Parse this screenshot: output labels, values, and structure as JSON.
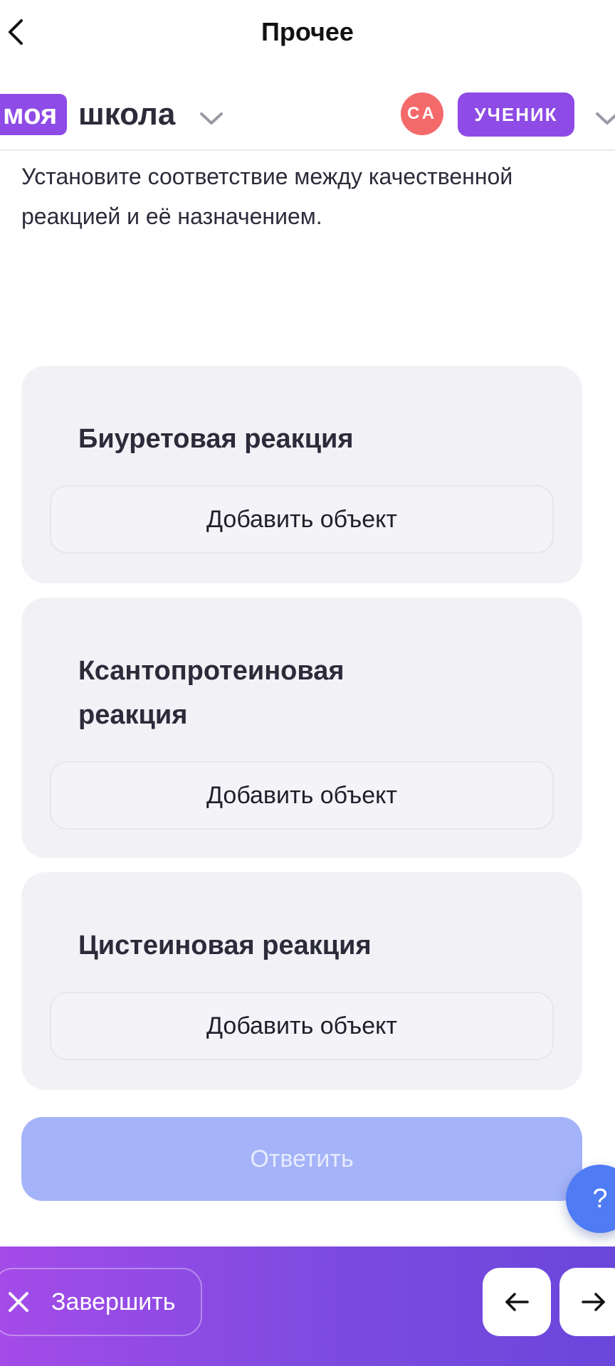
{
  "header": {
    "title": "Прочее"
  },
  "school": {
    "logo_badge": "моя",
    "logo_text": "школа",
    "avatar_initials": "СА",
    "role": "УЧЕНИК"
  },
  "question": {
    "text": "Установите соответствие между качественной реакцией и её назначением."
  },
  "cards": [
    {
      "title": "Биуретовая реакция",
      "add_label": "Добавить объект"
    },
    {
      "title": "Ксантопротеиновая реакция",
      "add_label": "Добавить объект"
    },
    {
      "title": "Цистеиновая реакция",
      "add_label": "Добавить объект"
    }
  ],
  "answer_button": {
    "label": "Ответить"
  },
  "help_button": {
    "label": "?"
  },
  "bottom": {
    "finish_label": "Завершить"
  },
  "colors": {
    "accent_purple": "#8e4be6",
    "answer_disabled": "#a5b4f8",
    "help_blue": "#4f7cf5",
    "avatar_red": "#f46a6a"
  }
}
